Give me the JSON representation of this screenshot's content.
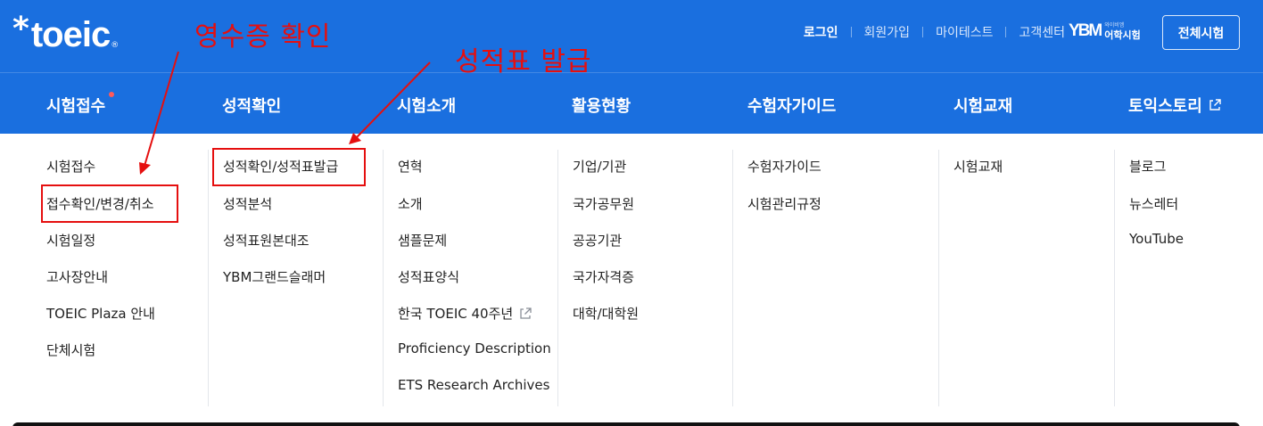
{
  "logo": {
    "text": "toeic",
    "star": "*",
    "reg": "®"
  },
  "util_links": [
    "로그인",
    "회원가입",
    "마이테스트",
    "고객센터"
  ],
  "ybm": {
    "mark": "YBM",
    "sub_small": "와이비엠",
    "sub": "어학시험"
  },
  "all_test_button": "전체시험",
  "gnb": [
    "시험접수",
    "성적확인",
    "시험소개",
    "활용현황",
    "수험자가이드",
    "시험교재",
    "토익스토리"
  ],
  "menu_columns": [
    [
      "시험접수",
      "접수확인/변경/취소",
      "시험일정",
      "고사장안내",
      "TOEIC Plaza 안내",
      "단체시험"
    ],
    [
      "성적확인/성적표발급",
      "성적분석",
      "성적표원본대조",
      "YBM그랜드슬래머"
    ],
    [
      "연혁",
      "소개",
      "샘플문제",
      "성적표양식",
      "한국 TOEIC 40주년",
      "Proficiency Description",
      "ETS Research Archives"
    ],
    [
      "기업/기관",
      "국가공무원",
      "공공기관",
      "국가자격증",
      "대학/대학원"
    ],
    [
      "수험자가이드",
      "시험관리규정"
    ],
    [
      "시험교재"
    ],
    [
      "블로그",
      "뉴스레터",
      "YouTube"
    ]
  ],
  "annotations": {
    "label1": "영수증 확인",
    "label2": "성적표 발급"
  },
  "colors": {
    "header": "#1a6fdf",
    "annotation": "#e50f0f",
    "text": "#222222"
  }
}
